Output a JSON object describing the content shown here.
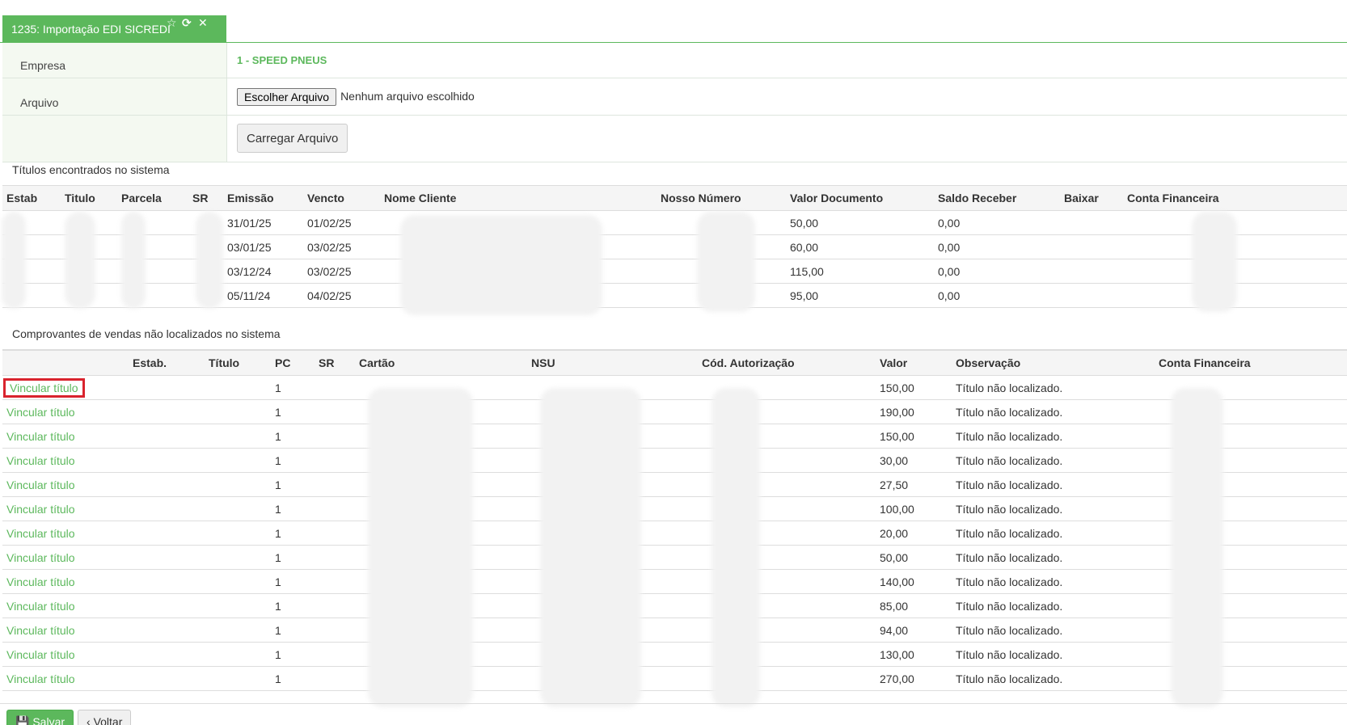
{
  "tab": {
    "title": "1235: Importação EDI SICREDI",
    "icons": [
      "star-icon",
      "refresh-icon",
      "close-icon"
    ]
  },
  "form": {
    "empresa_label": "Empresa",
    "empresa_value": "1 - SPEED PNEUS",
    "arquivo_label": "Arquivo",
    "file_button": "Escolher Arquivo",
    "file_status": "Nenhum arquivo escolhido",
    "load_button": "Carregar Arquivo"
  },
  "titulos": {
    "title": "Títulos encontrados no sistema",
    "columns": [
      "Estab",
      "Titulo",
      "Parcela",
      "SR",
      "Emissão",
      "Vencto",
      "Nome Cliente",
      "Nosso Número",
      "Valor Documento",
      "Saldo Receber",
      "Baixar",
      "Conta Financeira"
    ],
    "rows": [
      {
        "emissao": "31/01/25",
        "vencto": "01/02/25",
        "valor": "50,00",
        "saldo": "0,00"
      },
      {
        "emissao": "03/01/25",
        "vencto": "03/02/25",
        "valor": "60,00",
        "saldo": "0,00"
      },
      {
        "emissao": "03/12/24",
        "vencto": "03/02/25",
        "valor": "115,00",
        "saldo": "0,00"
      },
      {
        "emissao": "05/11/24",
        "vencto": "04/02/25",
        "valor": "95,00",
        "saldo": "0,00"
      }
    ]
  },
  "comprovantes": {
    "title": "Comprovantes de vendas não localizados no sistema",
    "columns": [
      "",
      "Estab.",
      "Título",
      "PC",
      "SR",
      "Cartão",
      "NSU",
      "Cód. Autorização",
      "Valor",
      "Observação",
      "Conta Financeira"
    ],
    "link_label": "Vincular título",
    "rows": [
      {
        "pc": "1",
        "valor": "150,00",
        "obs": "Título não localizado."
      },
      {
        "pc": "1",
        "valor": "190,00",
        "obs": "Título não localizado."
      },
      {
        "pc": "1",
        "valor": "150,00",
        "obs": "Título não localizado."
      },
      {
        "pc": "1",
        "valor": "30,00",
        "obs": "Título não localizado."
      },
      {
        "pc": "1",
        "valor": "27,50",
        "obs": "Título não localizado."
      },
      {
        "pc": "1",
        "valor": "100,00",
        "obs": "Título não localizado."
      },
      {
        "pc": "1",
        "valor": "20,00",
        "obs": "Título não localizado."
      },
      {
        "pc": "1",
        "valor": "50,00",
        "obs": "Título não localizado."
      },
      {
        "pc": "1",
        "valor": "140,00",
        "obs": "Título não localizado."
      },
      {
        "pc": "1",
        "valor": "85,00",
        "obs": "Título não localizado."
      },
      {
        "pc": "1",
        "valor": "94,00",
        "obs": "Título não localizado."
      },
      {
        "pc": "1",
        "valor": "130,00",
        "obs": "Título não localizado."
      },
      {
        "pc": "1",
        "valor": "270,00",
        "obs": "Título não localizado."
      }
    ]
  },
  "footer": {
    "save_label": "Salvar",
    "back_label": "Voltar"
  },
  "colors": {
    "accent": "#5cb85c",
    "highlight": "#d9232d"
  }
}
